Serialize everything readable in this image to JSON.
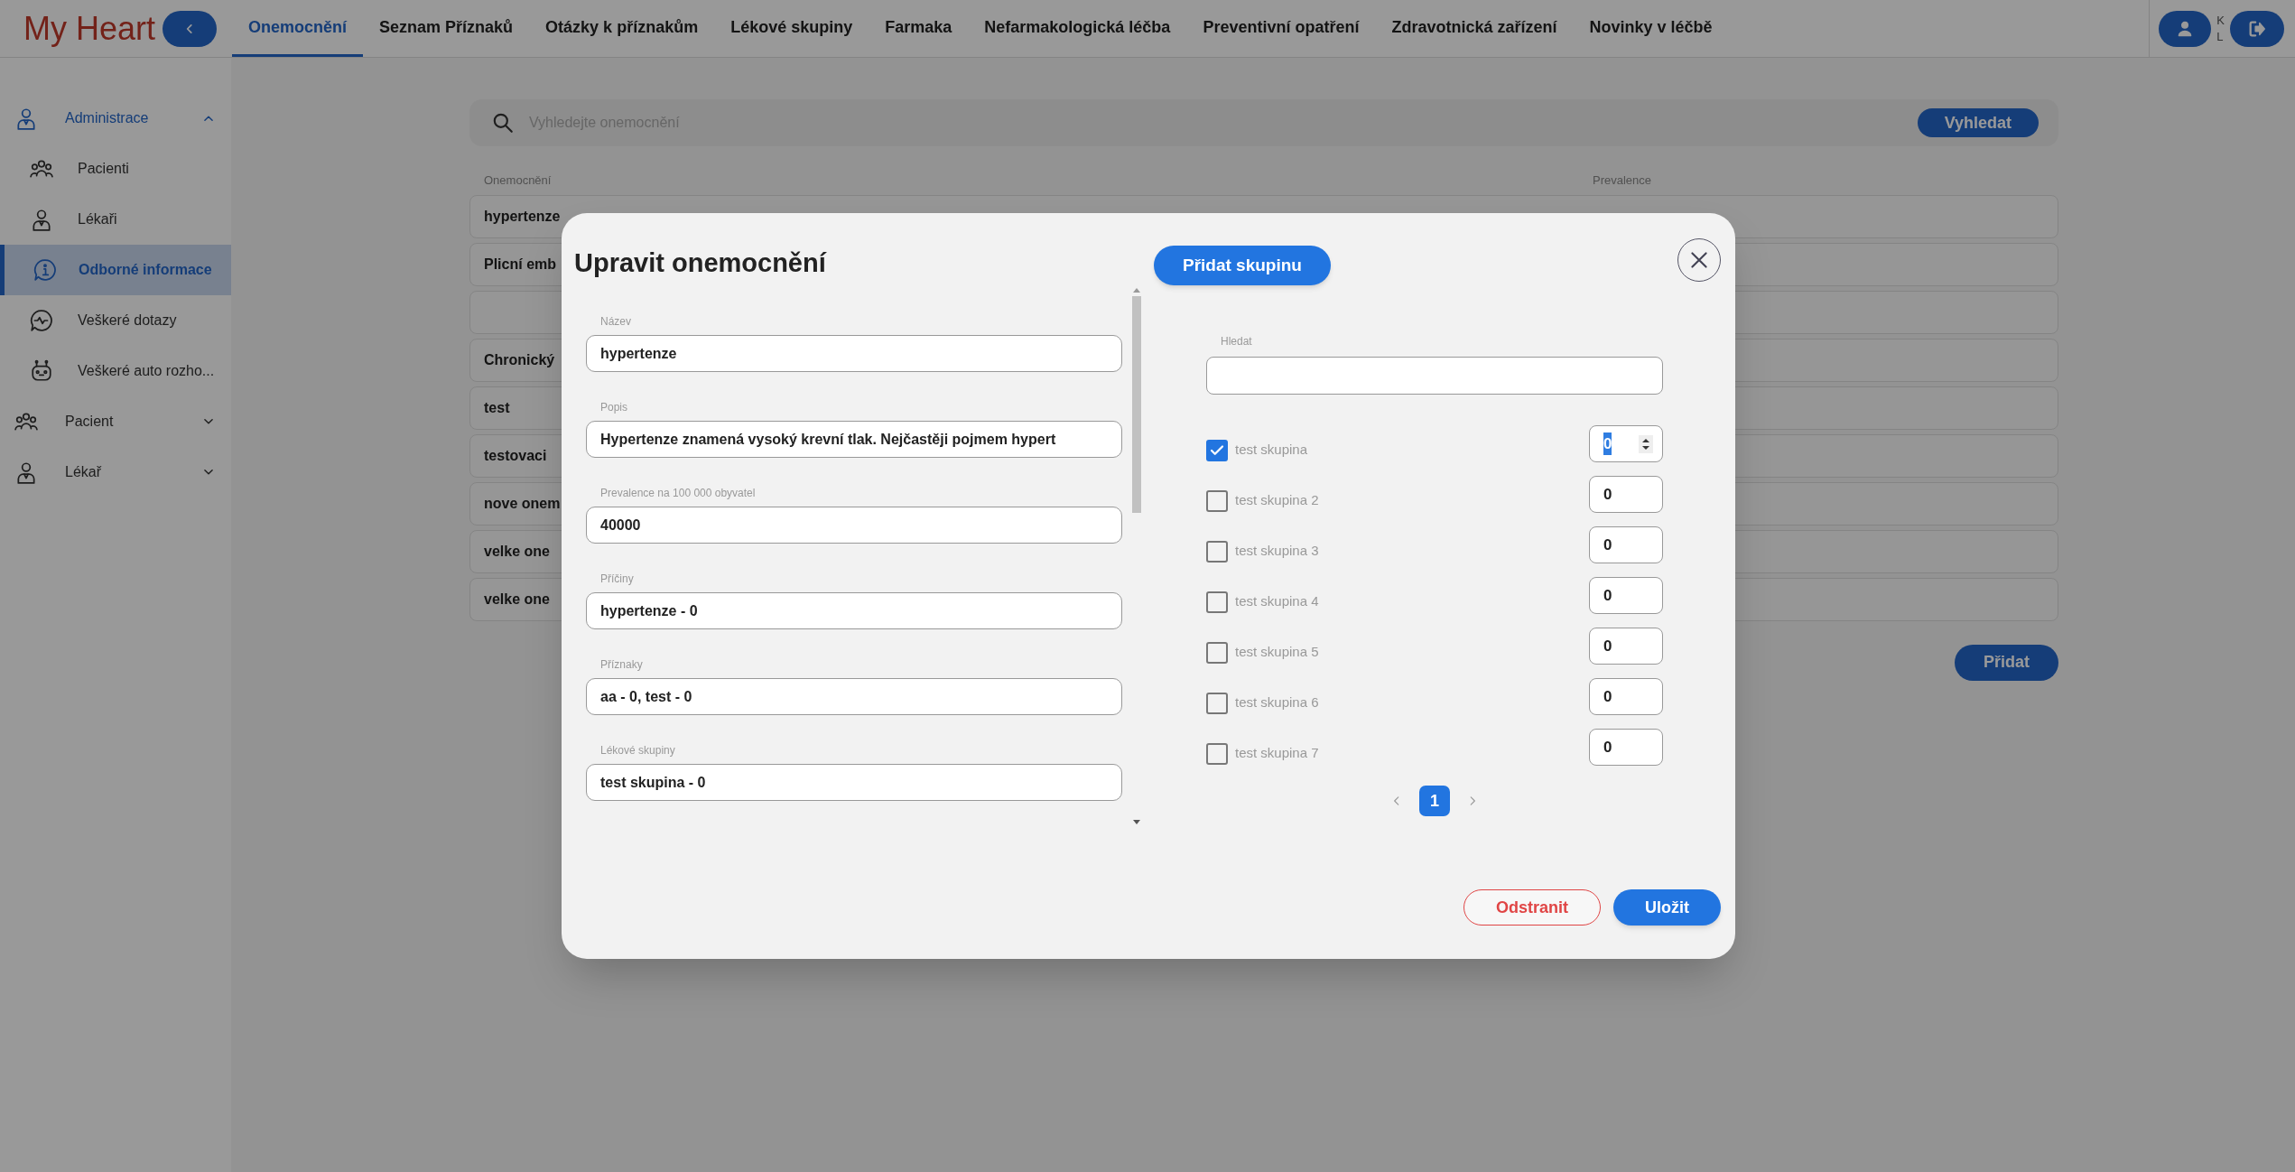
{
  "app": {
    "logo": "My Heart"
  },
  "nav": {
    "tabs": [
      {
        "label": "Onemocnění",
        "selected": true
      },
      {
        "label": "Seznam Příznaků",
        "selected": false
      },
      {
        "label": "Otázky k příznakům",
        "selected": false
      },
      {
        "label": "Lékové skupiny",
        "selected": false
      },
      {
        "label": "Farmaka",
        "selected": false
      },
      {
        "label": "Nefarmakologická léčba",
        "selected": false
      },
      {
        "label": "Preventivní opatření",
        "selected": false
      },
      {
        "label": "Zdravotnická zařízení",
        "selected": false
      },
      {
        "label": "Novinky v léčbě",
        "selected": false
      }
    ]
  },
  "user": {
    "initials": [
      "K",
      "L"
    ]
  },
  "sidebar": {
    "items": [
      {
        "label": "Administrace",
        "expanded": true,
        "children": [
          {
            "label": "Pacienti",
            "selected": false
          },
          {
            "label": "Lékaři",
            "selected": false
          },
          {
            "label": "Odborné informace",
            "selected": true
          },
          {
            "label": "Veškeré dotazy",
            "selected": false
          },
          {
            "label": "Veškeré auto rozho...",
            "selected": false
          }
        ]
      },
      {
        "label": "Pacient",
        "expanded": false
      },
      {
        "label": "Lékař",
        "expanded": false
      }
    ]
  },
  "search": {
    "placeholder": "Vyhledejte onemocnění",
    "button": "Vyhledat"
  },
  "table": {
    "columns": [
      "Onemocnění",
      "Prevalence"
    ],
    "rows": [
      {
        "name": "hypertenze"
      },
      {
        "name": "Plicní emb"
      },
      {
        "name": ""
      },
      {
        "name": "Chronický"
      },
      {
        "name": "test"
      },
      {
        "name": "testovaci"
      },
      {
        "name": "nove onem"
      },
      {
        "name": "velke one"
      },
      {
        "name": "velke one"
      }
    ]
  },
  "add_button": "Přidat",
  "modal": {
    "title": "Upravit onemocnění",
    "add_group_button": "Přidat skupinu",
    "fields": [
      {
        "label": "Název",
        "value": "hypertenze"
      },
      {
        "label": "Popis",
        "value": "Hypertenze znamená vysoký krevní tlak. Nejčastěji pojmem hypert"
      },
      {
        "label": "Prevalence na 100 000 obyvatel",
        "value": "40000"
      },
      {
        "label": "Příčiny",
        "value": "hypertenze - 0"
      },
      {
        "label": "Příznaky",
        "value": "aa - 0, test - 0"
      },
      {
        "label": "Lékové skupiny",
        "value": "test skupina - 0"
      }
    ],
    "group_search": {
      "label": "Hledat"
    },
    "groups": [
      {
        "label": "test skupina",
        "checked": true,
        "value": "0",
        "focused": true
      },
      {
        "label": "test skupina 2",
        "checked": false,
        "value": "0",
        "focused": false
      },
      {
        "label": "test skupina 3",
        "checked": false,
        "value": "0",
        "focused": false
      },
      {
        "label": "test skupina 4",
        "checked": false,
        "value": "0",
        "focused": false
      },
      {
        "label": "test skupina 5",
        "checked": false,
        "value": "0",
        "focused": false
      },
      {
        "label": "test skupina 6",
        "checked": false,
        "value": "0",
        "focused": false
      },
      {
        "label": "test skupina 7",
        "checked": false,
        "value": "0",
        "focused": false
      }
    ],
    "pagination": {
      "pages": [
        {
          "label": "1",
          "selected": true
        }
      ]
    },
    "delete_button": "Odstranit",
    "save_button": "Uložit"
  }
}
